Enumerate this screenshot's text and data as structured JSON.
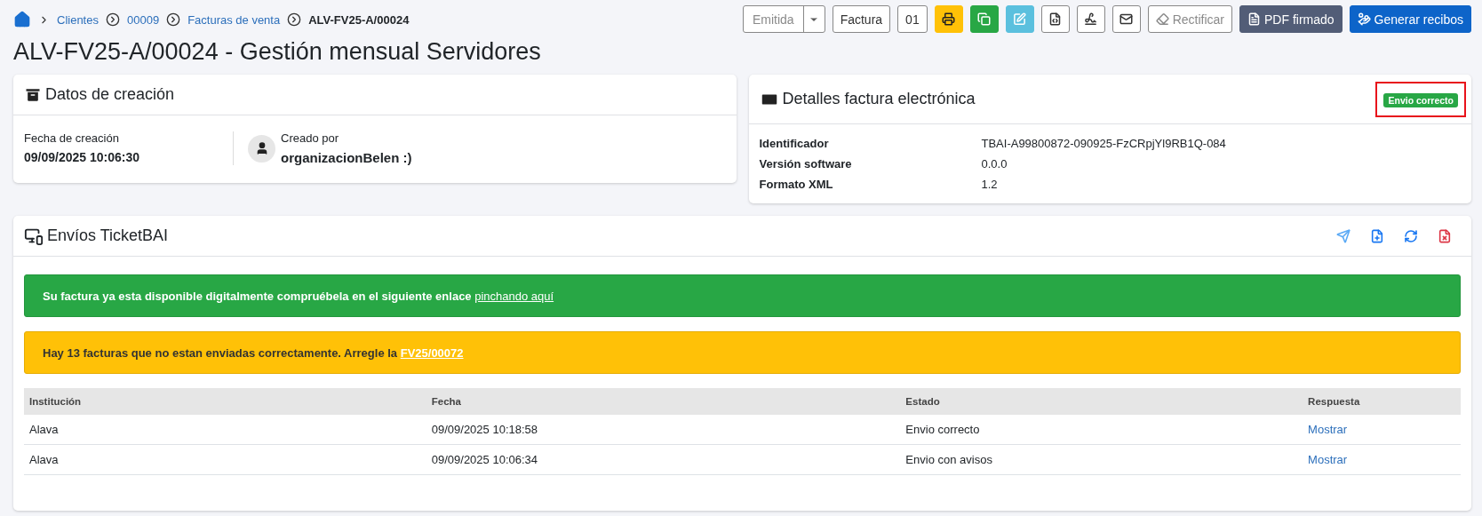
{
  "breadcrumb": [
    {
      "kind": "home"
    },
    {
      "kind": "link",
      "label": "Clientes"
    },
    {
      "kind": "link",
      "label": "00009"
    },
    {
      "kind": "link",
      "label": "Facturas de venta"
    },
    {
      "kind": "current",
      "label": "ALV-FV25-A/00024"
    }
  ],
  "toolbar": [
    {
      "kind": "split",
      "label": "Emitida",
      "disabled": true
    },
    {
      "kind": "text",
      "label": "Factura",
      "disabled": false
    },
    {
      "kind": "text",
      "label": "01",
      "disabled": false
    },
    {
      "kind": "icon",
      "disabled": false
    },
    {
      "kind": "icon",
      "disabled": false
    },
    {
      "kind": "icon",
      "disabled": false
    },
    {
      "kind": "icon",
      "disabled": false
    },
    {
      "kind": "icon",
      "disabled": false
    },
    {
      "kind": "icon",
      "disabled": false
    },
    {
      "kind": "text",
      "label": "Rectificar",
      "disabled": true
    },
    {
      "kind": "text",
      "label": "PDF firmado",
      "disabled": false
    },
    {
      "kind": "text",
      "label": "Generar recibos",
      "disabled": false
    }
  ],
  "title": "ALV-FV25-A/00024 - Gestión mensual Servidores",
  "creation_card": {
    "title": "Datos de creación",
    "date_label": "Fecha de creación",
    "date": "09/09/2025 10:06:30",
    "creator_label": "Creado por",
    "creator": "organizacionBelen :)"
  },
  "einvoice_card": {
    "title": "Detalles factura electrónica",
    "badge": {
      "label": "Envio correcto",
      "highlighted": true
    },
    "fields": [
      {
        "label": "Identificador",
        "value": "TBAI-A99800872-090925-FzCRpjYl9RB1Q-084"
      },
      {
        "label": "Versión software",
        "value": "0.0.0"
      },
      {
        "label": "Formato XML",
        "value": "1.2"
      }
    ]
  },
  "ticketbai_card": {
    "title": "Envíos TicketBAI",
    "alerts": [
      {
        "kind": "success",
        "text": "Su factura ya esta disponible digitalmente compruébela en el siguiente enlace ",
        "link": "pinchando aquí"
      },
      {
        "kind": "warning",
        "text": "Hay 13 facturas que no estan enviadas correctamente. Arregle la ",
        "link": "FV25/00072"
      }
    ],
    "table": {
      "columns": [
        "Institución",
        "Fecha",
        "Estado",
        "Respuesta"
      ],
      "rows": [
        [
          "Alava",
          "09/09/2025 10:18:58",
          "Envio correcto",
          "Mostrar"
        ],
        [
          "Alava",
          "09/09/2025 10:06:34",
          "Envio con avisos",
          "Mostrar"
        ]
      ]
    }
  }
}
